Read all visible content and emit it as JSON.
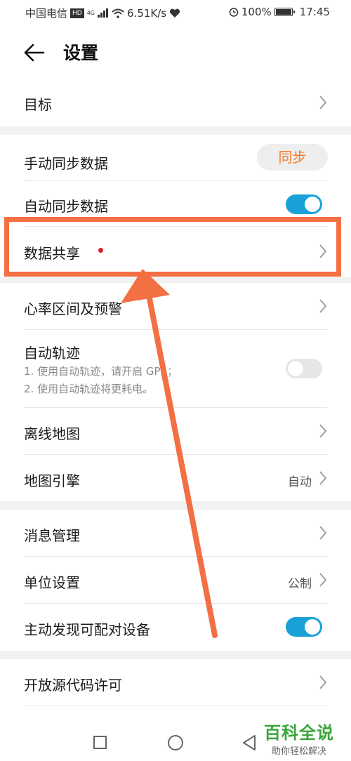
{
  "status_bar": {
    "carrier": "中国电信",
    "hd": "HD",
    "network": "4G",
    "speed": "6.51K/s",
    "battery": "100%",
    "time": "17:45"
  },
  "header": {
    "title": "设置"
  },
  "rows": {
    "goal": "目标",
    "manual_sync": "手动同步数据",
    "sync_button": "同步",
    "auto_sync": "自动同步数据",
    "auto_sync_on": true,
    "data_share": "数据共享",
    "heart_rate": "心率区间及预警",
    "auto_track": "自动轨迹",
    "auto_track_note1": "1. 使用自动轨迹，请开启 GPS；",
    "auto_track_note2": "2. 使用自动轨迹将更耗电。",
    "auto_track_on": false,
    "offline_map": "离线地图",
    "map_engine": "地图引擎",
    "map_engine_value": "自动",
    "message_mgmt": "消息管理",
    "unit_settings": "单位设置",
    "unit_value": "公制",
    "discover_devices": "主动发现可配对设备",
    "discover_on": true,
    "open_source": "开放源代码许可"
  },
  "watermark": {
    "title": "百科全说",
    "subtitle": "助你轻松解决"
  },
  "colors": {
    "accent_orange": "#f07b2a",
    "toggle_on": "#1aa2d8",
    "annotation": "#f36f44",
    "badge_red": "#e0202a"
  }
}
